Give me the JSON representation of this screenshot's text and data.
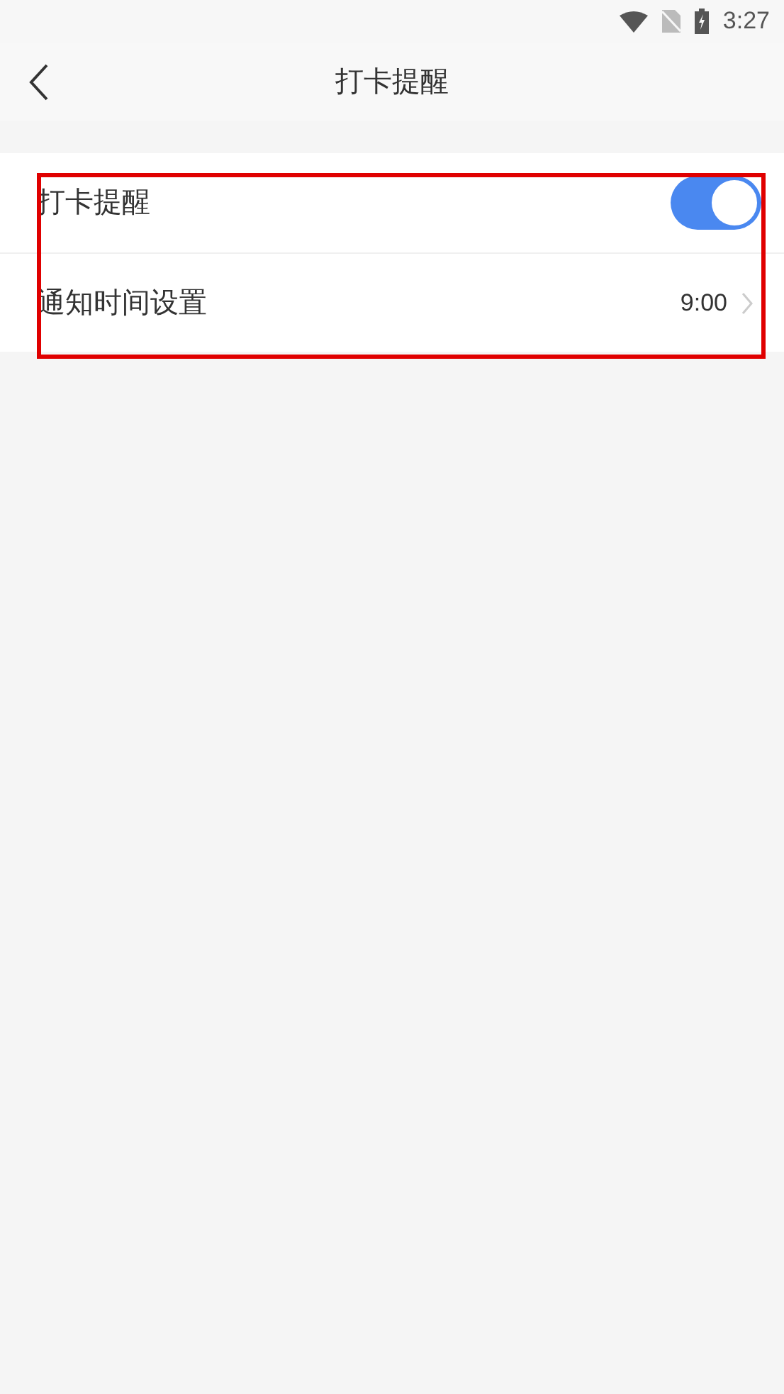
{
  "status_bar": {
    "time": "3:27"
  },
  "header": {
    "title": "打卡提醒"
  },
  "settings": [
    {
      "kind": "toggle",
      "label": "打卡提醒",
      "on": true
    },
    {
      "kind": "link",
      "label": "通知时间设置",
      "value": "9:00"
    }
  ]
}
